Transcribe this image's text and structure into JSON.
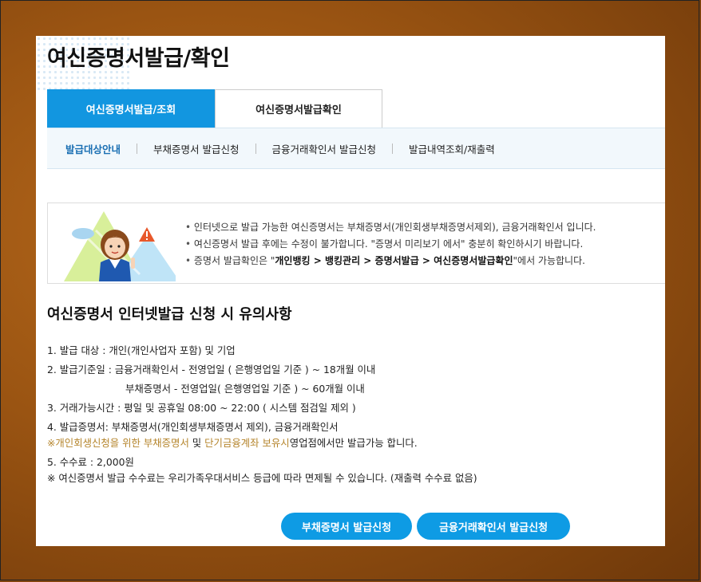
{
  "page": {
    "title": "여신증명서발급/확인"
  },
  "tabs": [
    {
      "label": "여신증명서발급/조회",
      "active": true
    },
    {
      "label": "여신증명서발급확인",
      "active": false
    }
  ],
  "subnav": [
    {
      "label": "발급대상안내"
    },
    {
      "label": "부채증명서 발급신청"
    },
    {
      "label": "금융거래확인서 발급신청"
    },
    {
      "label": "발급내역조회/재출력"
    }
  ],
  "notice": {
    "line1": "인터넷으로 발급 가능한 여신증명서는 부채증명서(개인회생부채증명서제외), 금융거래확인서 입니다.",
    "line2": "여신증명서 발급 후에는 수정이 불가합니다. \"증명서 미리보기 에서\" 충분히 확인하시기 바랍니다.",
    "line3_prefix": "증명서 발급확인은 \"",
    "line3_bold": "개인뱅킹 > 뱅킹관리 > 증명서발급 > 여신증명서발급확인",
    "line3_suffix": "\"에서 가능합니다."
  },
  "section": {
    "title": "여신증명서 인터넷발급 신청 시 유의사항",
    "item1": "1. 발급 대상 : 개인(개인사업자 포함) 및 기업",
    "item2a": "2. 발급기준일 : 금융거래확인서 - 전영업일 ( 은행영업일 기준 ) ~ 18개월 이내",
    "item2b": "부채증명서 - 전영업일( 은행영업일 기준 ) ~ 60개월 이내",
    "item3": "3. 거래가능시간 : 평일 및 공휴일 08:00 ~ 22:00 ( 시스템 점검일 제외 )",
    "item4": "4. 발급증명서: 부채증명서(개인회생부채증명서 제외), 금융거래확인서",
    "note1_mark": "※",
    "note1_hl1": "개인회생신청을 위한 부채증명서",
    "note1_mid": " 및 ",
    "note1_hl2": "단기금융계좌 보유시",
    "note1_end": "영업점에서만 발급가능 합니다.",
    "item5": "5. 수수료 : 2,000원",
    "note2": "※ 여신증명서 발급 수수료는 우리가족우대서비스 등급에 따라 면제될 수 있습니다. (재출력 수수료 없음)"
  },
  "buttons": {
    "debt": "부채증명서 발급신청",
    "finance": "금융거래확인서 발급신청"
  },
  "colors": {
    "accent": "#1296e0",
    "highlight": "#b5852c"
  }
}
